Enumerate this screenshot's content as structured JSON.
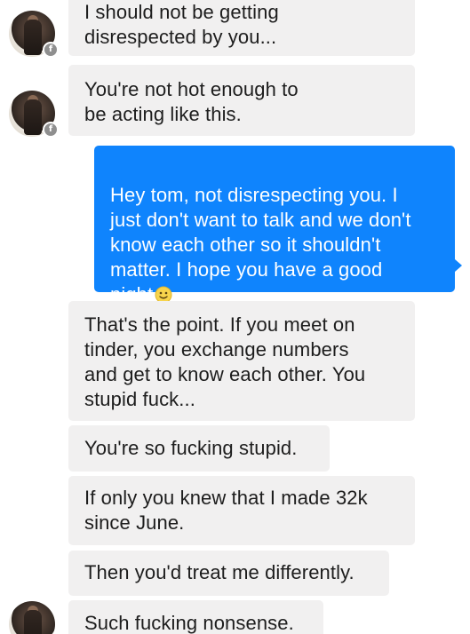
{
  "conversation": {
    "messages": [
      {
        "sender": "them",
        "text": "I should not be getting\ndisrespected by you..."
      },
      {
        "sender": "them",
        "text": "You're not hot enough to\nbe acting like this."
      },
      {
        "sender": "me",
        "text": "Hey tom, not disrespecting you.  I\njust don't want to talk and we don't\nknow each other so it shouldn't\nmatter. I hope you have a good\nnight",
        "emoji": "slightly-smiling-face-icon"
      },
      {
        "sender": "them",
        "text": "That's the point.  If you meet on\ntinder, you exchange numbers\nand get to know each other.  You\nstupid fuck..."
      },
      {
        "sender": "them",
        "text": "You're so fucking stupid."
      },
      {
        "sender": "them",
        "text": "If only you knew that I made 32k\nsince June."
      },
      {
        "sender": "them",
        "text": "Then you'd treat me differently."
      },
      {
        "sender": "them",
        "text": "Such fucking nonsense."
      }
    ]
  },
  "colors": {
    "outgoing_bubble": "#0f84fd",
    "incoming_bubble": "#f1f0f0",
    "incoming_text": "#1d1d1d"
  },
  "icons": {
    "avatar_badge": "facebook-f-icon"
  }
}
